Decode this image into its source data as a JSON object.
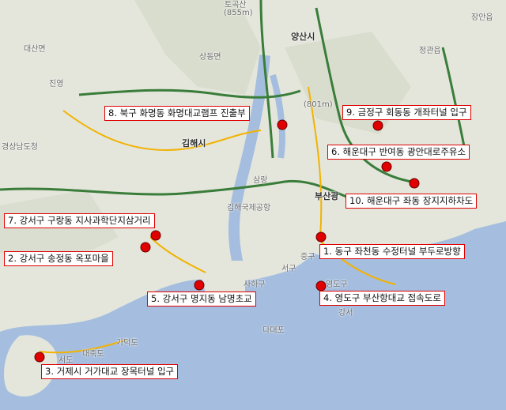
{
  "map": {
    "places": [
      {
        "key": "tosan_top",
        "text": "토곡산"
      },
      {
        "key": "tosan_elev",
        "text": "(855m)"
      },
      {
        "key": "yangsan",
        "text": "양산시"
      },
      {
        "key": "gimhae",
        "text": "김해시"
      },
      {
        "key": "busan",
        "text": "부산광"
      },
      {
        "key": "gyeongnam",
        "text": "경상남도청"
      },
      {
        "key": "gimhae_airport",
        "text": "김해국제공항"
      },
      {
        "key": "geumjeong_elev",
        "text": "(801m)"
      },
      {
        "key": "saha",
        "text": "사하구"
      },
      {
        "key": "seogu",
        "text": "서구"
      },
      {
        "key": "jungu",
        "text": "중구"
      },
      {
        "key": "yeongdo",
        "text": "영도구"
      },
      {
        "key": "dadaepo",
        "text": "다대포"
      },
      {
        "key": "gadeokdo",
        "text": "가덕도"
      },
      {
        "key": "daehangdo",
        "text": "대죽도"
      },
      {
        "key": "seodo",
        "text": "서도"
      },
      {
        "key": "gangseo",
        "text": "강서"
      },
      {
        "key": "sangdong",
        "text": "상동면"
      },
      {
        "key": "jinyeong",
        "text": "진영"
      },
      {
        "key": "daesan",
        "text": "대산면"
      },
      {
        "key": "samrang",
        "text": "삼랑"
      },
      {
        "key": "jeonggwan",
        "text": "정관읍"
      },
      {
        "key": "jangan",
        "text": "장안읍"
      }
    ],
    "locations": [
      {
        "id": "1",
        "label": "1. 동구 좌천동 수정터널 부두로방향"
      },
      {
        "id": "2",
        "label": "2. 강서구 송정동 옥포마을"
      },
      {
        "id": "3",
        "label": "3. 거제시 거가대교 장목터널 입구"
      },
      {
        "id": "4",
        "label": "4. 영도구 부산항대교 접속도로"
      },
      {
        "id": "5",
        "label": "5. 강서구 명지동 남명초교"
      },
      {
        "id": "6",
        "label": "6. 해운대구 반여동 광안대로주유소"
      },
      {
        "id": "7",
        "label": "7. 강서구 구랑동 지사과학단지삼거리"
      },
      {
        "id": "8",
        "label": "8. 북구 화명동 화명대교램프 진출부"
      },
      {
        "id": "9",
        "label": "9. 금정구 회동동 개좌터널 입구"
      },
      {
        "id": "10",
        "label": "10. 해운대구 좌동 장지지하차도"
      }
    ],
    "colors": {
      "marker": "#e00000",
      "sea": "#a5bedf",
      "land": "#e4e6dc",
      "river": "#a5bedf",
      "highway": "#3a7d3a",
      "road": "#f2b200"
    }
  }
}
